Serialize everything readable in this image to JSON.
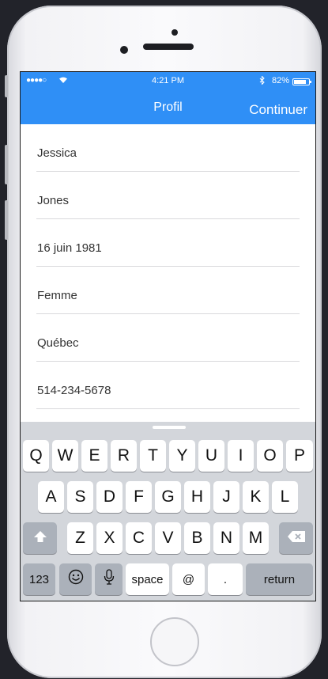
{
  "status_bar": {
    "carrier": "●●●●○",
    "wifi_icon": "wifi-icon",
    "time": "4:21 PM",
    "bluetooth_icon": "bluetooth-icon",
    "battery_percent": "82%",
    "battery_level": 0.82
  },
  "navbar": {
    "title": "Profil",
    "action_label": "Continuer",
    "color": "#2f8ff6"
  },
  "form": {
    "fields": [
      {
        "value": "Jessica"
      },
      {
        "value": "Jones"
      },
      {
        "value": "16 juin 1981"
      },
      {
        "value": "Femme"
      },
      {
        "value": "Québec"
      },
      {
        "value": "514-234-5678"
      }
    ]
  },
  "keyboard": {
    "row1": [
      "Q",
      "W",
      "E",
      "R",
      "T",
      "Y",
      "U",
      "I",
      "O",
      "P"
    ],
    "row2": [
      "A",
      "S",
      "D",
      "F",
      "G",
      "H",
      "J",
      "K",
      "L"
    ],
    "row3": [
      "Z",
      "X",
      "C",
      "V",
      "B",
      "N",
      "M"
    ],
    "shift_icon": "shift-icon",
    "backspace_icon": "backspace-icon",
    "numbers_label": "123",
    "emoji_icon": "emoji-icon",
    "mic_icon": "microphone-icon",
    "space_label": "space",
    "at_label": "@",
    "period_label": ".",
    "return_label": "return"
  }
}
